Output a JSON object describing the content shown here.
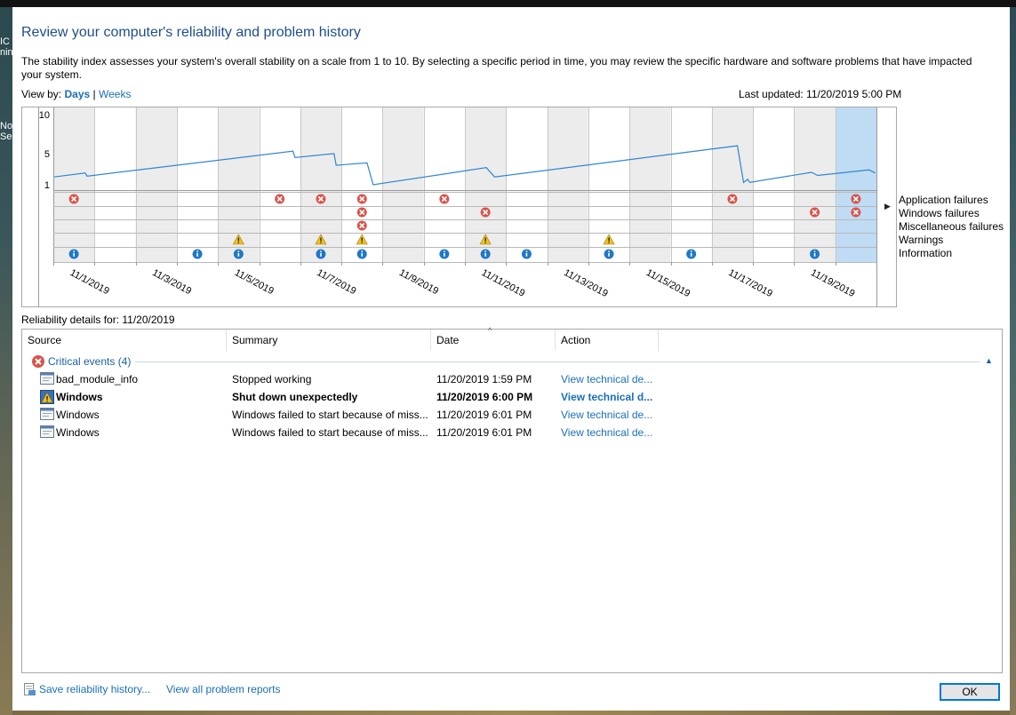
{
  "page": {
    "title": "Review your computer's reliability and problem history",
    "description": "The stability index assesses your system's overall stability on a scale from 1 to 10. By selecting a specific period in time, you may review the specific hardware and software problems that have impacted your system.",
    "view_by_label": "View by:",
    "view_days": "Days",
    "view_sep": "|",
    "view_weeks": "Weeks",
    "last_updated": "Last updated: 11/20/2019 5:00 PM",
    "details_for": "Reliability details for: 11/20/2019"
  },
  "desktop_fragments": [
    "IC",
    "nin",
    "No",
    "Sec"
  ],
  "chart": {
    "y_ticks": [
      "10",
      "5",
      "1"
    ],
    "date_labels": [
      "11/1/2019",
      "11/3/2019",
      "11/5/2019",
      "11/7/2019",
      "11/9/2019",
      "11/11/2019",
      "11/13/2019",
      "11/15/2019",
      "11/17/2019",
      "11/19/2019"
    ],
    "row_labels": [
      "Application failures",
      "Windows failures",
      "Miscellaneous failures",
      "Warnings",
      "Information"
    ],
    "selected_day_index": 19,
    "colors": {
      "line": "#2f87d0",
      "shade": "#ececec",
      "selected": "#c0dcf4",
      "error": "#d9534a",
      "warning": "#f2c21b",
      "info": "#1e78c8"
    }
  },
  "chart_data": {
    "type": "line",
    "y_range": [
      1,
      10
    ],
    "x_days": [
      "11/1/2019",
      "11/2/2019",
      "11/3/2019",
      "11/4/2019",
      "11/5/2019",
      "11/6/2019",
      "11/7/2019",
      "11/8/2019",
      "11/9/2019",
      "11/10/2019",
      "11/11/2019",
      "11/12/2019",
      "11/13/2019",
      "11/14/2019",
      "11/15/2019",
      "11/16/2019",
      "11/17/2019",
      "11/18/2019",
      "11/19/2019",
      "11/20/2019"
    ],
    "stability_points": [
      {
        "day": 0,
        "v": 2.0
      },
      {
        "day": 0.75,
        "v": 2.5
      },
      {
        "day": 0.8,
        "v": 2.1
      },
      {
        "day": 5.8,
        "v": 5.3
      },
      {
        "day": 5.85,
        "v": 4.5
      },
      {
        "day": 6.8,
        "v": 5.0
      },
      {
        "day": 6.85,
        "v": 3.5
      },
      {
        "day": 7.6,
        "v": 3.8
      },
      {
        "day": 7.75,
        "v": 1.0
      },
      {
        "day": 10.5,
        "v": 3.2
      },
      {
        "day": 10.7,
        "v": 2.0
      },
      {
        "day": 16.6,
        "v": 6.0
      },
      {
        "day": 16.75,
        "v": 1.3
      },
      {
        "day": 16.85,
        "v": 1.7
      },
      {
        "day": 16.9,
        "v": 1.3
      },
      {
        "day": 18.4,
        "v": 2.6
      },
      {
        "day": 18.55,
        "v": 2.2
      },
      {
        "day": 19.8,
        "v": 2.9
      },
      {
        "day": 19.95,
        "v": 2.5
      }
    ],
    "events": {
      "application_failures": [
        0,
        5,
        6,
        7,
        9,
        16,
        19
      ],
      "windows_failures": [
        7,
        10,
        18,
        19
      ],
      "miscellaneous_failures": [
        7
      ],
      "warnings": [
        4,
        6,
        7,
        10,
        13
      ],
      "information": [
        0,
        3,
        4,
        6,
        7,
        9,
        10,
        11,
        13,
        15,
        18
      ]
    }
  },
  "table": {
    "columns": [
      "Source",
      "Summary",
      "Date",
      "Action"
    ],
    "group_label": "Critical events (4)",
    "rows": [
      {
        "source": "bad_module_info",
        "summary": "Stopped working",
        "date": "11/20/2019 1:59 PM",
        "action": "View technical de..."
      },
      {
        "source": "Windows",
        "summary": "Shut down unexpectedly",
        "date": "11/20/2019 6:00 PM",
        "action": "View technical d..."
      },
      {
        "source": "Windows",
        "summary": "Windows failed to start because of miss...",
        "date": "11/20/2019 6:01 PM",
        "action": "View technical de..."
      },
      {
        "source": "Windows",
        "summary": "Windows failed to start because of miss...",
        "date": "11/20/2019 6:01 PM",
        "action": "View technical de..."
      }
    ]
  },
  "footer": {
    "save_history": "Save reliability history...",
    "view_all": "View all problem reports",
    "ok": "OK"
  }
}
